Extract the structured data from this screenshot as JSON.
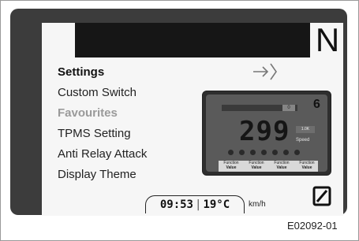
{
  "display": {
    "gear_indicator": "N",
    "menu": {
      "heading": "Settings",
      "items": [
        "Custom Switch",
        "Favourites",
        "TPMS Setting",
        "Anti Relay Attack",
        "Display Theme"
      ],
      "selected_index": 1
    },
    "enter_icon": "enter-arrow-icon",
    "preview": {
      "speed": "299",
      "unit": "Speed",
      "gear": "6",
      "badge": "1.0K",
      "bar_box": "0",
      "functions": [
        {
          "label": "Function",
          "value": "Value"
        },
        {
          "label": "Function",
          "value": "Value"
        },
        {
          "label": "Function",
          "value": "Value"
        },
        {
          "label": "Function",
          "value": "Value"
        }
      ]
    },
    "status_bar": {
      "time": "09:53",
      "separator": "|",
      "temperature": "19°C",
      "speed_unit": "km/h"
    },
    "zero_icon": "zero-slash-icon"
  },
  "figure": {
    "code": "E02092-01"
  },
  "colors": {
    "bezel": "#3c3c3c",
    "screen": "#f6f6f6",
    "topbar": "#161616",
    "selected_item": "#9a9a9a"
  }
}
